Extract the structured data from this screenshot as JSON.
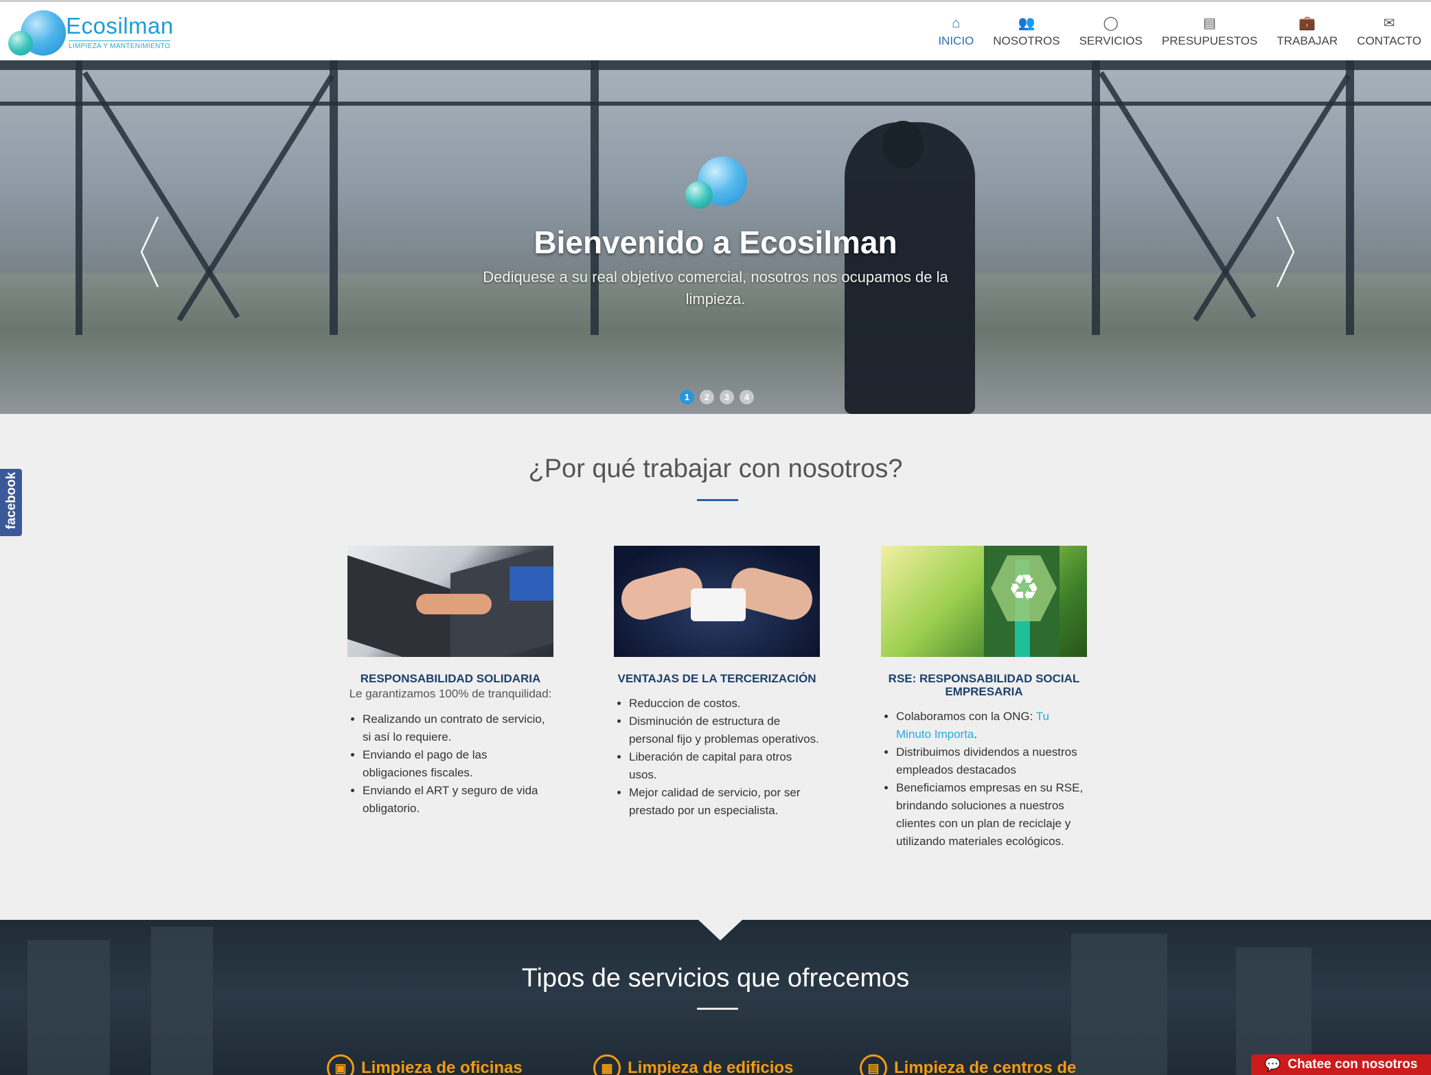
{
  "brand": {
    "name": "Ecosilman",
    "tagline": "LIMPIEZA Y MANTENIMIENTO"
  },
  "nav": [
    {
      "label": "INICIO",
      "icon": "home-icon",
      "glyph": "⌂",
      "active": true
    },
    {
      "label": "NOSOTROS",
      "icon": "users-icon",
      "glyph": "👥"
    },
    {
      "label": "SERVICIOS",
      "icon": "refresh-icon",
      "glyph": "◯"
    },
    {
      "label": "PRESUPUESTOS",
      "icon": "list-icon",
      "glyph": "▤"
    },
    {
      "label": "TRABAJAR",
      "icon": "briefcase-icon",
      "glyph": "💼"
    },
    {
      "label": "CONTACTO",
      "icon": "envelope-icon",
      "glyph": "✉"
    }
  ],
  "hero": {
    "title": "Bienvenido a Ecosilman",
    "subtitle": "Dediquese a su real objetivo comercial, nosotros nos ocupamos de la limpieza.",
    "dots": [
      "1",
      "2",
      "3",
      "4"
    ],
    "active_dot": "1"
  },
  "facebook": {
    "label": "facebook"
  },
  "why": {
    "title": "¿Por qué trabajar con nosotros?",
    "cards": [
      {
        "title": "RESPONSABILIDAD SOLIDARIA",
        "intro": "Le garantizamos 100% de tranquilidad:",
        "items": [
          "Realizando un contrato de servicio, si así lo requiere.",
          "Enviando el pago de las obligaciones fiscales.",
          "Enviando el ART y seguro de vida obligatorio."
        ]
      },
      {
        "title": "VENTAJAS DE LA TERCERIZACIÓN",
        "items": [
          "Reduccion de costos.",
          "Disminución de estructura de personal fijo y problemas operativos.",
          "Liberación de capital para otros usos.",
          "Mejor calidad de servicio, por ser prestado por un especialista."
        ]
      },
      {
        "title": "RSE: RESPONSABILIDAD SOCIAL EMPRESARIA",
        "item1_prefix": "Colaboramos con la ONG: ",
        "item1_link": "Tu Minuto Importa",
        "item1_suffix": ".",
        "items": [
          "Distribuimos dividendos a nuestros empleados destacados",
          "Beneficiamos empresas en su RSE, brindando soluciones a nuestros clientes con un plan de reciclaje y utilizando materiales ecológicos."
        ]
      }
    ]
  },
  "services": {
    "title": "Tipos de servicios que ofrecemos",
    "items": [
      {
        "label": "Limpieza de oficinas",
        "icon": "briefcase-icon"
      },
      {
        "label": "Limpieza de edificios",
        "icon": "building-icon"
      },
      {
        "label": "Limpieza de centros de",
        "icon": "hospital-icon"
      }
    ]
  },
  "chat": {
    "label": "Chatee con nosotros",
    "icon": "chat-icon"
  },
  "colors": {
    "accent": "#2a6fb0",
    "orange": "#f59a12",
    "chat": "#cc1b1b",
    "facebook": "#3b5998"
  }
}
